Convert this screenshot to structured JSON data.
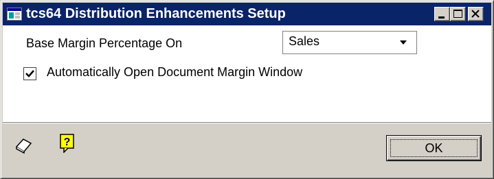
{
  "window": {
    "title": "tcs64 Distribution Enhancements Setup",
    "app_icon": "window-app-icon",
    "controls": [
      "minimize-icon",
      "maximize-icon",
      "close-icon"
    ]
  },
  "form": {
    "margin_label": "Base Margin Percentage On",
    "margin_select_value": "Sales",
    "auto_open_label": "Automatically Open Document Margin Window",
    "auto_open_checked": true
  },
  "footer": {
    "note_icon": "note-icon",
    "help_icon": "help-icon",
    "ok_label": "OK"
  },
  "colors": {
    "titlebar": "#0a246a",
    "face": "#d4d0c8",
    "body": "#ffffff"
  }
}
